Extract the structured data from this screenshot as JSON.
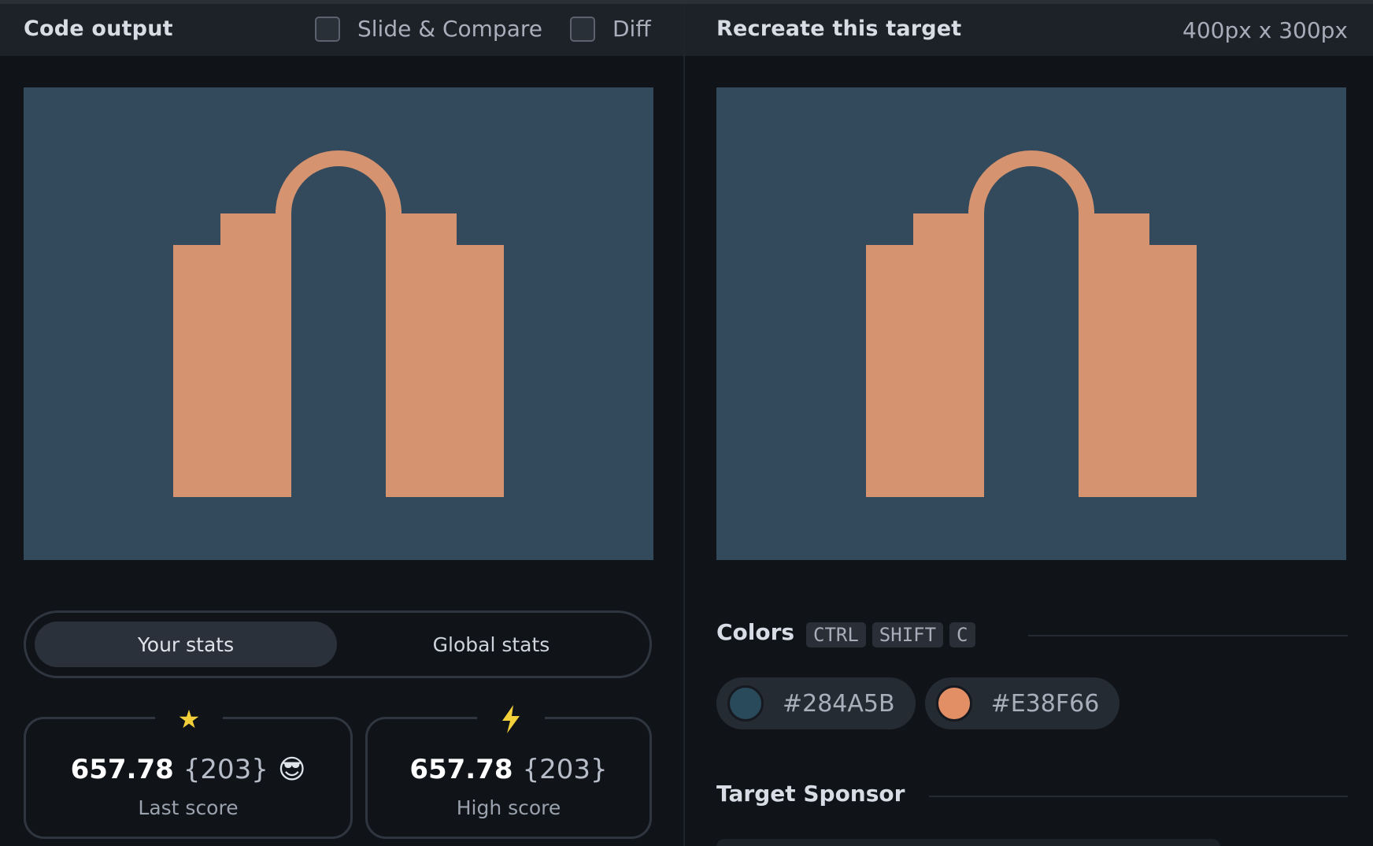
{
  "left_panel": {
    "title": "Code output",
    "slide_compare_label": "Slide & Compare",
    "diff_label": "Diff",
    "stats_tabs": {
      "your": "Your stats",
      "global": "Global stats"
    },
    "last_score": {
      "value": "657.78",
      "count": "{203}",
      "emoji": "😎",
      "label": "Last score",
      "icon": "star-icon"
    },
    "high_score": {
      "value": "657.78",
      "count": "{203}",
      "label": "High score",
      "icon": "lightning-icon"
    }
  },
  "right_panel": {
    "title": "Recreate this target",
    "dimensions": "400px x 300px",
    "colors_title": "Colors",
    "shortcut_keys": [
      "CTRL",
      "SHIFT",
      "C"
    ],
    "swatches": [
      {
        "label": "#284A5B",
        "color": "#284A5B"
      },
      {
        "label": "#E38F66",
        "color": "#E38F66"
      }
    ],
    "sponsor_title": "Target Sponsor"
  },
  "colors": {
    "canvas_bg": "#334a5d",
    "shape_fill": "#d6936f",
    "panel_bg": "#101318",
    "header_bg": "#1d2229"
  }
}
